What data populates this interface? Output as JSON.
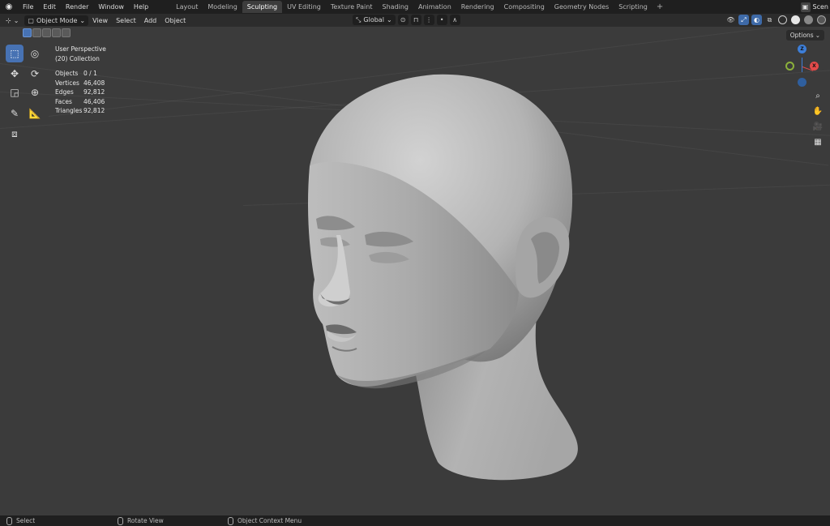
{
  "menubar": {
    "items": [
      "File",
      "Edit",
      "Render",
      "Window",
      "Help"
    ],
    "workspaces": [
      "Layout",
      "Modeling",
      "Sculpting",
      "UV Editing",
      "Texture Paint",
      "Shading",
      "Animation",
      "Rendering",
      "Compositing",
      "Geometry Nodes",
      "Scripting"
    ],
    "active_workspace": "Sculpting",
    "scene_label": "Scen"
  },
  "header": {
    "mode": "Object Mode",
    "menus": [
      "View",
      "Select",
      "Add",
      "Object"
    ],
    "orientation": "Global"
  },
  "overlay_info": {
    "view_name": "User Perspective",
    "collection": "(20) Collection",
    "stats": [
      {
        "label": "Objects",
        "value": "0 / 1"
      },
      {
        "label": "Vertices",
        "value": "46,408"
      },
      {
        "label": "Edges",
        "value": "92,812"
      },
      {
        "label": "Faces",
        "value": "46,406"
      },
      {
        "label": "Triangles",
        "value": "92,812"
      }
    ]
  },
  "viewport": {
    "options_label": "Options",
    "gizmo": {
      "z": "Z",
      "x": "X"
    }
  },
  "statusbar": {
    "select": "Select",
    "rotate": "Rotate View",
    "context": "Object Context Menu"
  },
  "colors": {
    "accent": "#4772b3",
    "viewport_bg": "#3b3b3b",
    "axis_x": "#e34a4a",
    "axis_y": "#8bb03b",
    "axis_z": "#3d7ed8"
  }
}
